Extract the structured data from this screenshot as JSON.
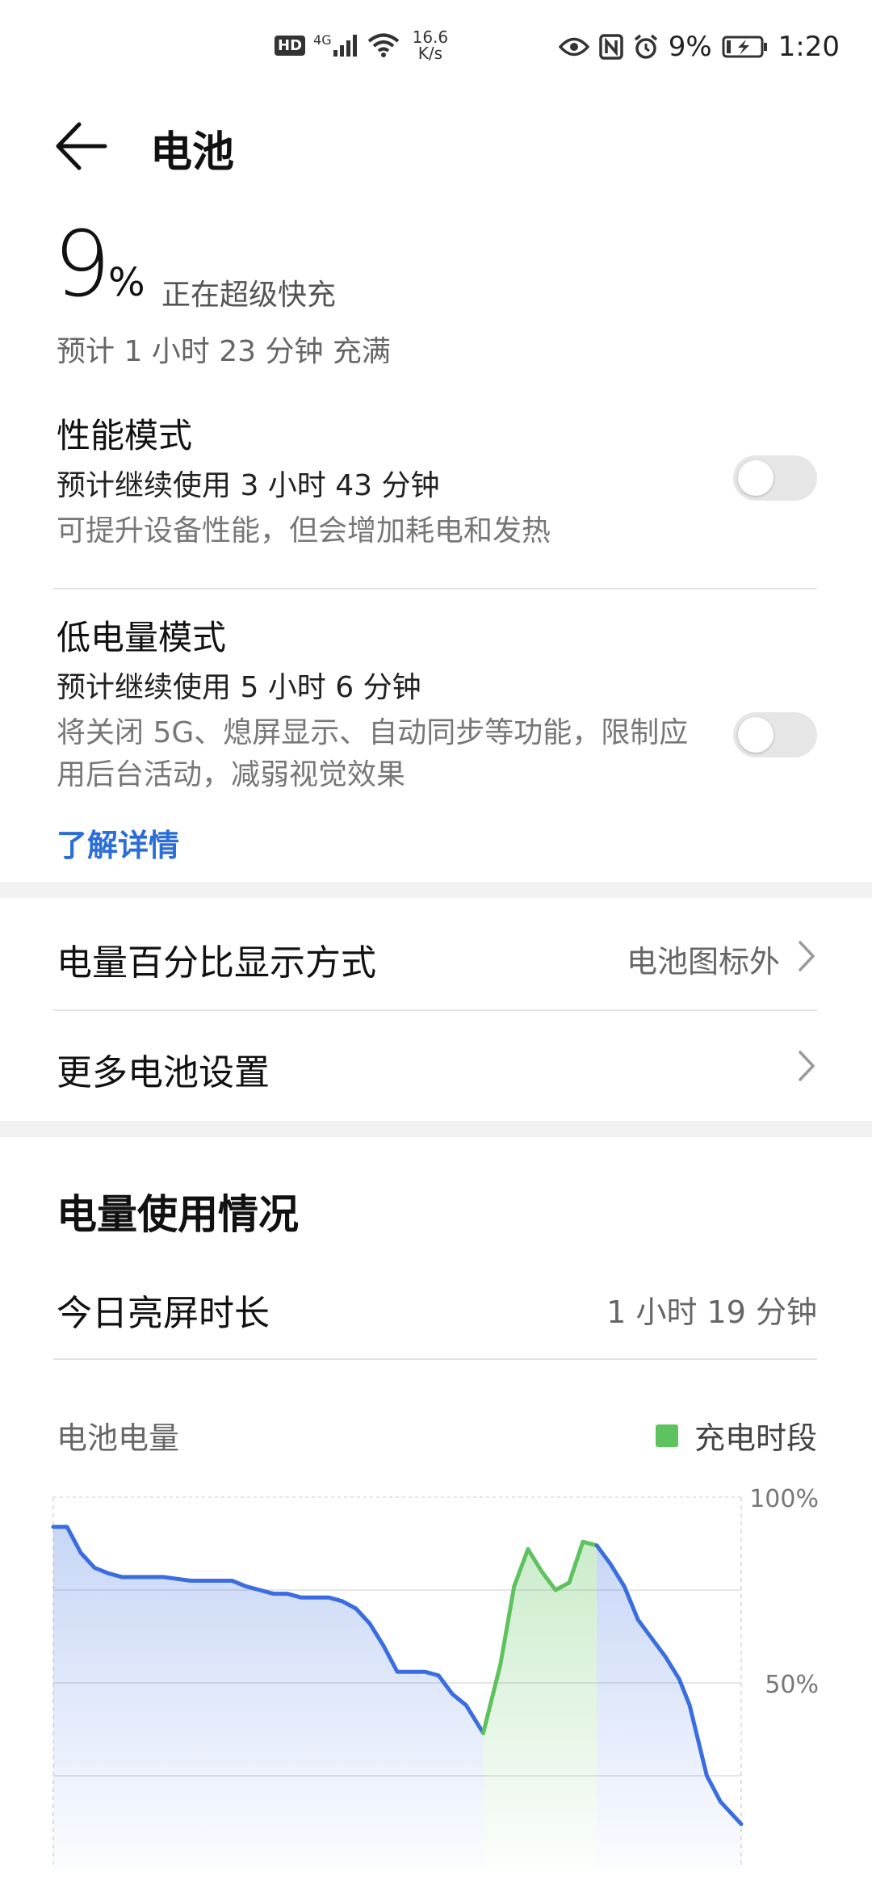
{
  "status_bar": {
    "hd": "HD",
    "network": "4G",
    "speed_value": "16.6",
    "speed_unit": "K/s",
    "battery_pct": "9%",
    "time": "1:20"
  },
  "header": {
    "title": "电池"
  },
  "battery": {
    "level": "9",
    "percent_sign": "%",
    "charging_state": "正在超级快充",
    "full_estimate": "预计 1 小时 23 分钟 充满"
  },
  "performance_mode": {
    "title": "性能模式",
    "remaining": "预计继续使用 3 小时 43 分钟",
    "description": "可提升设备性能，但会增加耗电和发热",
    "enabled": false
  },
  "low_power_mode": {
    "title": "低电量模式",
    "remaining": "预计继续使用 5 小时 6 分钟",
    "description": "将关闭 5G、熄屏显示、自动同步等功能，限制应用后台活动，减弱视觉效果",
    "enabled": false,
    "learn_more": "了解详情"
  },
  "settings": {
    "percent_display_label": "电量百分比显示方式",
    "percent_display_value": "电池图标外",
    "more_settings_label": "更多电池设置"
  },
  "usage": {
    "title": "电量使用情况",
    "screen_time_label": "今日亮屏时长",
    "screen_time_value": "1 小时 19 分钟",
    "chart_label": "电池电量",
    "legend_charging": "充电时段"
  },
  "colors": {
    "line_discharge": "#3a6ee0",
    "line_charge": "#5ec25e",
    "accent_link": "#2c6ed8"
  },
  "chart_data": {
    "type": "line",
    "ylabels": [
      "100%",
      "50%"
    ],
    "ylim": [
      0,
      100
    ],
    "grid": true,
    "series": [
      {
        "segment": "discharge",
        "points": [
          [
            0,
            92
          ],
          [
            2,
            92
          ],
          [
            4,
            85
          ],
          [
            6,
            81
          ],
          [
            8,
            79.5
          ],
          [
            10,
            78.5
          ],
          [
            12,
            78.5
          ],
          [
            16,
            78.5
          ],
          [
            18,
            78
          ],
          [
            20,
            77.5
          ],
          [
            22,
            77.5
          ],
          [
            26,
            77.5
          ],
          [
            28,
            76
          ],
          [
            30,
            75
          ],
          [
            32,
            74
          ],
          [
            34,
            74
          ],
          [
            36,
            73
          ],
          [
            40,
            73
          ],
          [
            42,
            72
          ],
          [
            44,
            70
          ],
          [
            46,
            66
          ],
          [
            48,
            60
          ],
          [
            50,
            53
          ],
          [
            54,
            53
          ],
          [
            56,
            52
          ],
          [
            58,
            47
          ],
          [
            60,
            44
          ],
          [
            62.5,
            36.5
          ]
        ]
      },
      {
        "segment": "charging",
        "points": [
          [
            62.5,
            36.5
          ],
          [
            65,
            55
          ],
          [
            67,
            76
          ],
          [
            69,
            86
          ],
          [
            71,
            80
          ],
          [
            73,
            75
          ],
          [
            75,
            77
          ],
          [
            77,
            88
          ],
          [
            79,
            87
          ]
        ]
      },
      {
        "segment": "discharge",
        "points": [
          [
            79,
            87
          ],
          [
            81,
            82
          ],
          [
            83,
            76
          ],
          [
            85,
            67
          ],
          [
            87,
            62
          ],
          [
            89,
            57
          ],
          [
            91,
            51
          ],
          [
            92.5,
            44
          ],
          [
            95,
            25
          ],
          [
            97,
            18
          ],
          [
            100,
            12
          ]
        ]
      }
    ]
  }
}
